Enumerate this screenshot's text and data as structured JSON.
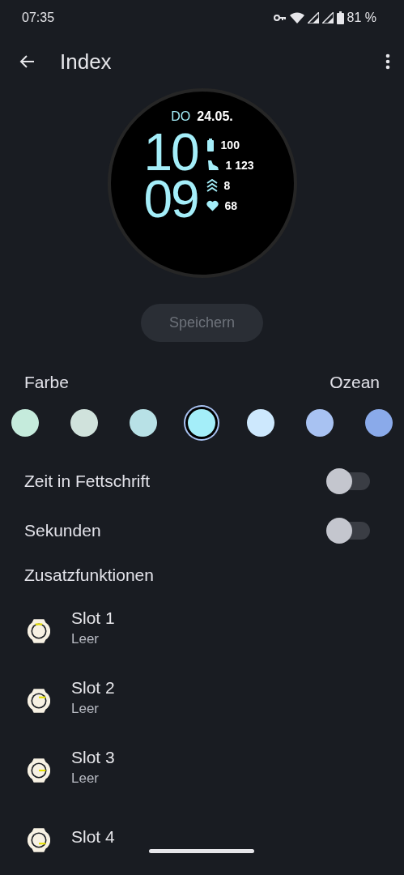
{
  "status_bar": {
    "time": "07:35",
    "battery": "81 %"
  },
  "app_bar": {
    "title": "Index"
  },
  "watch_face": {
    "weekday": "DO",
    "date": "24.05.",
    "hours": "10",
    "minutes": "09",
    "complications": [
      {
        "kind": "battery",
        "value": "100"
      },
      {
        "kind": "steps",
        "value": "1 123"
      },
      {
        "kind": "floors",
        "value": "8"
      },
      {
        "kind": "heart",
        "value": "68"
      }
    ]
  },
  "save_button": {
    "label": "Speichern",
    "disabled": true
  },
  "color_section": {
    "label": "Farbe",
    "value": "Ozean",
    "swatches": [
      {
        "color": "#c5ebdc",
        "selected": false
      },
      {
        "color": "#d0e2dc",
        "selected": false
      },
      {
        "color": "#b8e1e6",
        "selected": false
      },
      {
        "color": "#a4eef9",
        "selected": true
      },
      {
        "color": "#cde8fd",
        "selected": false
      },
      {
        "color": "#a8c2f2",
        "selected": false
      },
      {
        "color": "#8aaaea",
        "selected": false
      }
    ]
  },
  "toggles": [
    {
      "label": "Zeit in Fettschrift",
      "on": false
    },
    {
      "label": "Sekunden",
      "on": false
    }
  ],
  "complications_section": {
    "title": "Zusatzfunktionen",
    "slots": [
      {
        "name": "Slot 1",
        "status": "Leer",
        "kind": "top"
      },
      {
        "name": "Slot 2",
        "status": "Leer",
        "kind": "upper-right"
      },
      {
        "name": "Slot 3",
        "status": "Leer",
        "kind": "right"
      },
      {
        "name": "Slot 4",
        "kind": "lower-right"
      }
    ]
  }
}
